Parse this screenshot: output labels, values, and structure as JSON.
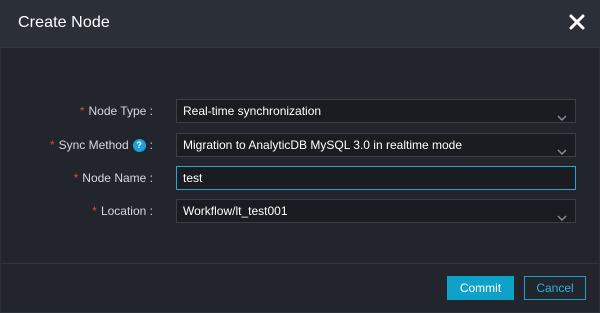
{
  "dialog": {
    "title": "Create Node",
    "close_icon": "close-icon"
  },
  "form": {
    "required_mark": "*",
    "node_type": {
      "label": "Node Type :",
      "value": "Real-time synchronization"
    },
    "sync_method": {
      "label": "Sync Method",
      "help_icon": "help-icon",
      "help_glyph": "?",
      "colon": ":",
      "value": "Migration to AnalyticDB MySQL 3.0 in realtime mode"
    },
    "node_name": {
      "label": "Node Name :",
      "value": "test"
    },
    "location": {
      "label": "Location :",
      "value": "Workflow/lt_test001"
    }
  },
  "footer": {
    "commit_label": "Commit",
    "cancel_label": "Cancel"
  },
  "colors": {
    "required": "#e0483e",
    "accent": "#0ea2c8",
    "background": "#22252b"
  }
}
